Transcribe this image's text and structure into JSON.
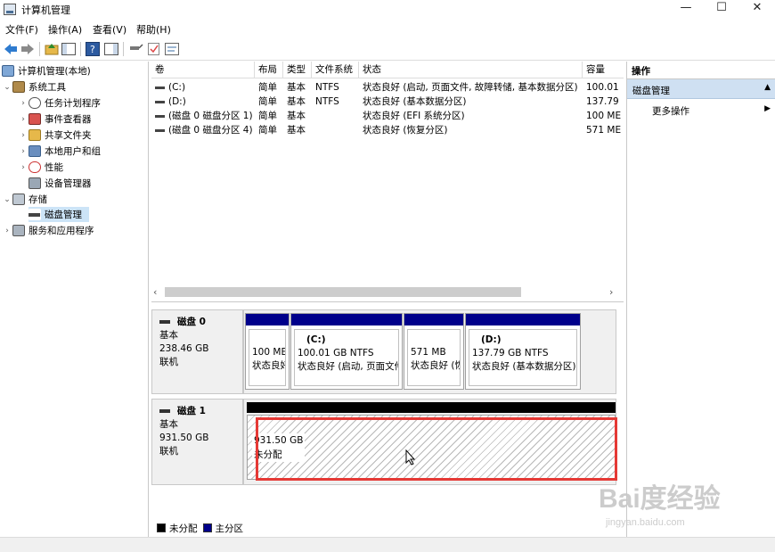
{
  "window": {
    "title": "计算机管理",
    "minimize": "—",
    "maximize": "☐",
    "close": "✕"
  },
  "menu": [
    "文件(F)",
    "操作(A)",
    "查看(V)",
    "帮助(H)"
  ],
  "tree": {
    "root": "计算机管理(本地)",
    "system_tools": "系统工具",
    "task_scheduler": "任务计划程序",
    "event_viewer": "事件查看器",
    "shared_folders": "共享文件夹",
    "local_users": "本地用户和组",
    "performance": "性能",
    "device_manager": "设备管理器",
    "storage": "存储",
    "disk_management": "磁盘管理",
    "services_apps": "服务和应用程序"
  },
  "list": {
    "headers": [
      "卷",
      "布局",
      "类型",
      "文件系统",
      "状态",
      "容量"
    ],
    "rows": [
      {
        "vol": "(C:)",
        "layout": "简单",
        "type": "基本",
        "fs": "NTFS",
        "status": "状态良好 (启动, 页面文件, 故障转储, 基本数据分区)",
        "cap": "100.01"
      },
      {
        "vol": "(D:)",
        "layout": "简单",
        "type": "基本",
        "fs": "NTFS",
        "status": "状态良好 (基本数据分区)",
        "cap": "137.79"
      },
      {
        "vol": "(磁盘 0 磁盘分区 1)",
        "layout": "简单",
        "type": "基本",
        "fs": "",
        "status": "状态良好 (EFI 系统分区)",
        "cap": "100 ME"
      },
      {
        "vol": "(磁盘 0 磁盘分区 4)",
        "layout": "简单",
        "type": "基本",
        "fs": "",
        "status": "状态良好 (恢复分区)",
        "cap": "571 ME"
      }
    ]
  },
  "disk0": {
    "name": "磁盘 0",
    "type": "基本",
    "size": "238.46 GB",
    "state": "联机",
    "partitions": [
      {
        "title": "",
        "size": "100 ME",
        "status": "状态良好"
      },
      {
        "title": "(C:)",
        "size": "100.01 GB NTFS",
        "status": "状态良好 (启动, 页面文件"
      },
      {
        "title": "",
        "size": "571 MB",
        "status": "状态良好 (恢"
      },
      {
        "title": "(D:)",
        "size": "137.79 GB NTFS",
        "status": "状态良好 (基本数据分区)"
      }
    ]
  },
  "disk1": {
    "name": "磁盘 1",
    "type": "基本",
    "size": "931.50 GB",
    "state": "联机",
    "unallocated": {
      "size": "931.50 GB",
      "label": "未分配"
    }
  },
  "legend": [
    {
      "label": "未分配",
      "color": "#000000"
    },
    {
      "label": "主分区",
      "color": "#00008b"
    }
  ],
  "actions": {
    "header": "操作",
    "section": "磁盘管理",
    "more": "更多操作"
  },
  "watermark": {
    "brand": "Bai度经验",
    "site": "jingyan.baidu.com"
  }
}
